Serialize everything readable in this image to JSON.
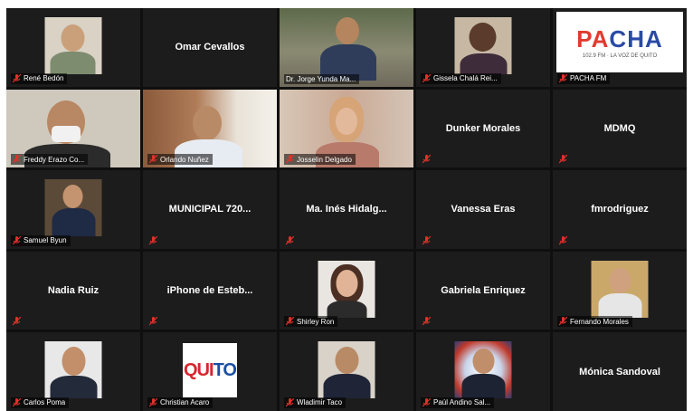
{
  "participants": [
    {
      "name": "René Bedón",
      "type": "video"
    },
    {
      "name": "Omar Cevallos",
      "type": "name"
    },
    {
      "name": "Dr. Jorge Yunda Ma...",
      "type": "video",
      "active": true
    },
    {
      "name": "Gissela Chalá Rei...",
      "type": "video"
    },
    {
      "name": "PACHA FM",
      "type": "logo-pacha"
    },
    {
      "name": "Freddy Erazo Co...",
      "type": "video"
    },
    {
      "name": "Orlando Nuñez",
      "type": "video"
    },
    {
      "name": "Josselin Delgado",
      "type": "video"
    },
    {
      "name": "Dunker Morales",
      "type": "name"
    },
    {
      "name": "MDMQ",
      "type": "name"
    },
    {
      "name": "Samuel Byun",
      "type": "video"
    },
    {
      "name": "MUNICIPAL 720...",
      "type": "name"
    },
    {
      "name": "Ma. Inés Hidalg...",
      "type": "name"
    },
    {
      "name": "Vanessa Eras",
      "type": "name"
    },
    {
      "name": "fmrodriguez",
      "type": "name"
    },
    {
      "name": "Nadia Ruiz",
      "type": "name"
    },
    {
      "name": "iPhone de Esteb...",
      "type": "name"
    },
    {
      "name": "Shirley Ron",
      "type": "video"
    },
    {
      "name": "Gabriela Enriquez",
      "type": "name"
    },
    {
      "name": "Fernando Morales",
      "type": "video"
    },
    {
      "name": "Carlos Poma",
      "type": "video"
    },
    {
      "name": "Christian Acaro",
      "type": "logo-quito"
    },
    {
      "name": "Wladimir Taco",
      "type": "video"
    },
    {
      "name": "Paúl Andino Sal...",
      "type": "video"
    },
    {
      "name": "Mónica Sandoval",
      "type": "name"
    }
  ],
  "logos": {
    "pacha_word_a": "PA",
    "pacha_word_b": "CHA",
    "pacha_tag": "102.9 FM · LA VOZ DE QUITO",
    "quito_a": "QUI",
    "quito_b": "TO"
  },
  "colors": {
    "active_border": "#a4d233",
    "mute_icon": "#e0312b",
    "tile_bg": "#1c1c1c"
  }
}
